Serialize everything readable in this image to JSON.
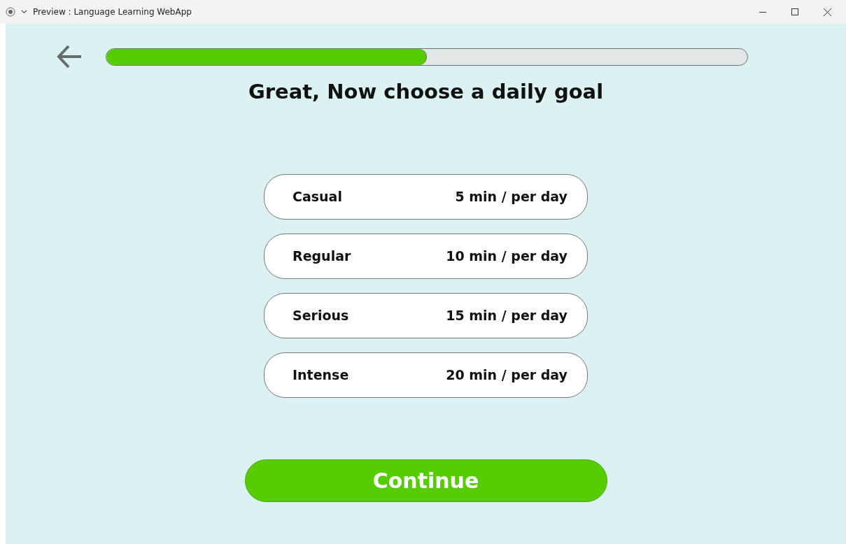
{
  "window": {
    "title": "Preview : Language Learning WebApp"
  },
  "progress": {
    "level": 0.5
  },
  "heading": "Great, Now choose a daily goal",
  "goals": [
    {
      "label": "Casual",
      "duration": "5 min / per day",
      "selected": false
    },
    {
      "label": "Regular",
      "duration": "10 min / per day",
      "selected": false
    },
    {
      "label": "Serious",
      "duration": "15 min / per day",
      "selected": false
    },
    {
      "label": "Intense",
      "duration": "20 min / per day",
      "selected": false
    }
  ],
  "continue_button": "Continue"
}
